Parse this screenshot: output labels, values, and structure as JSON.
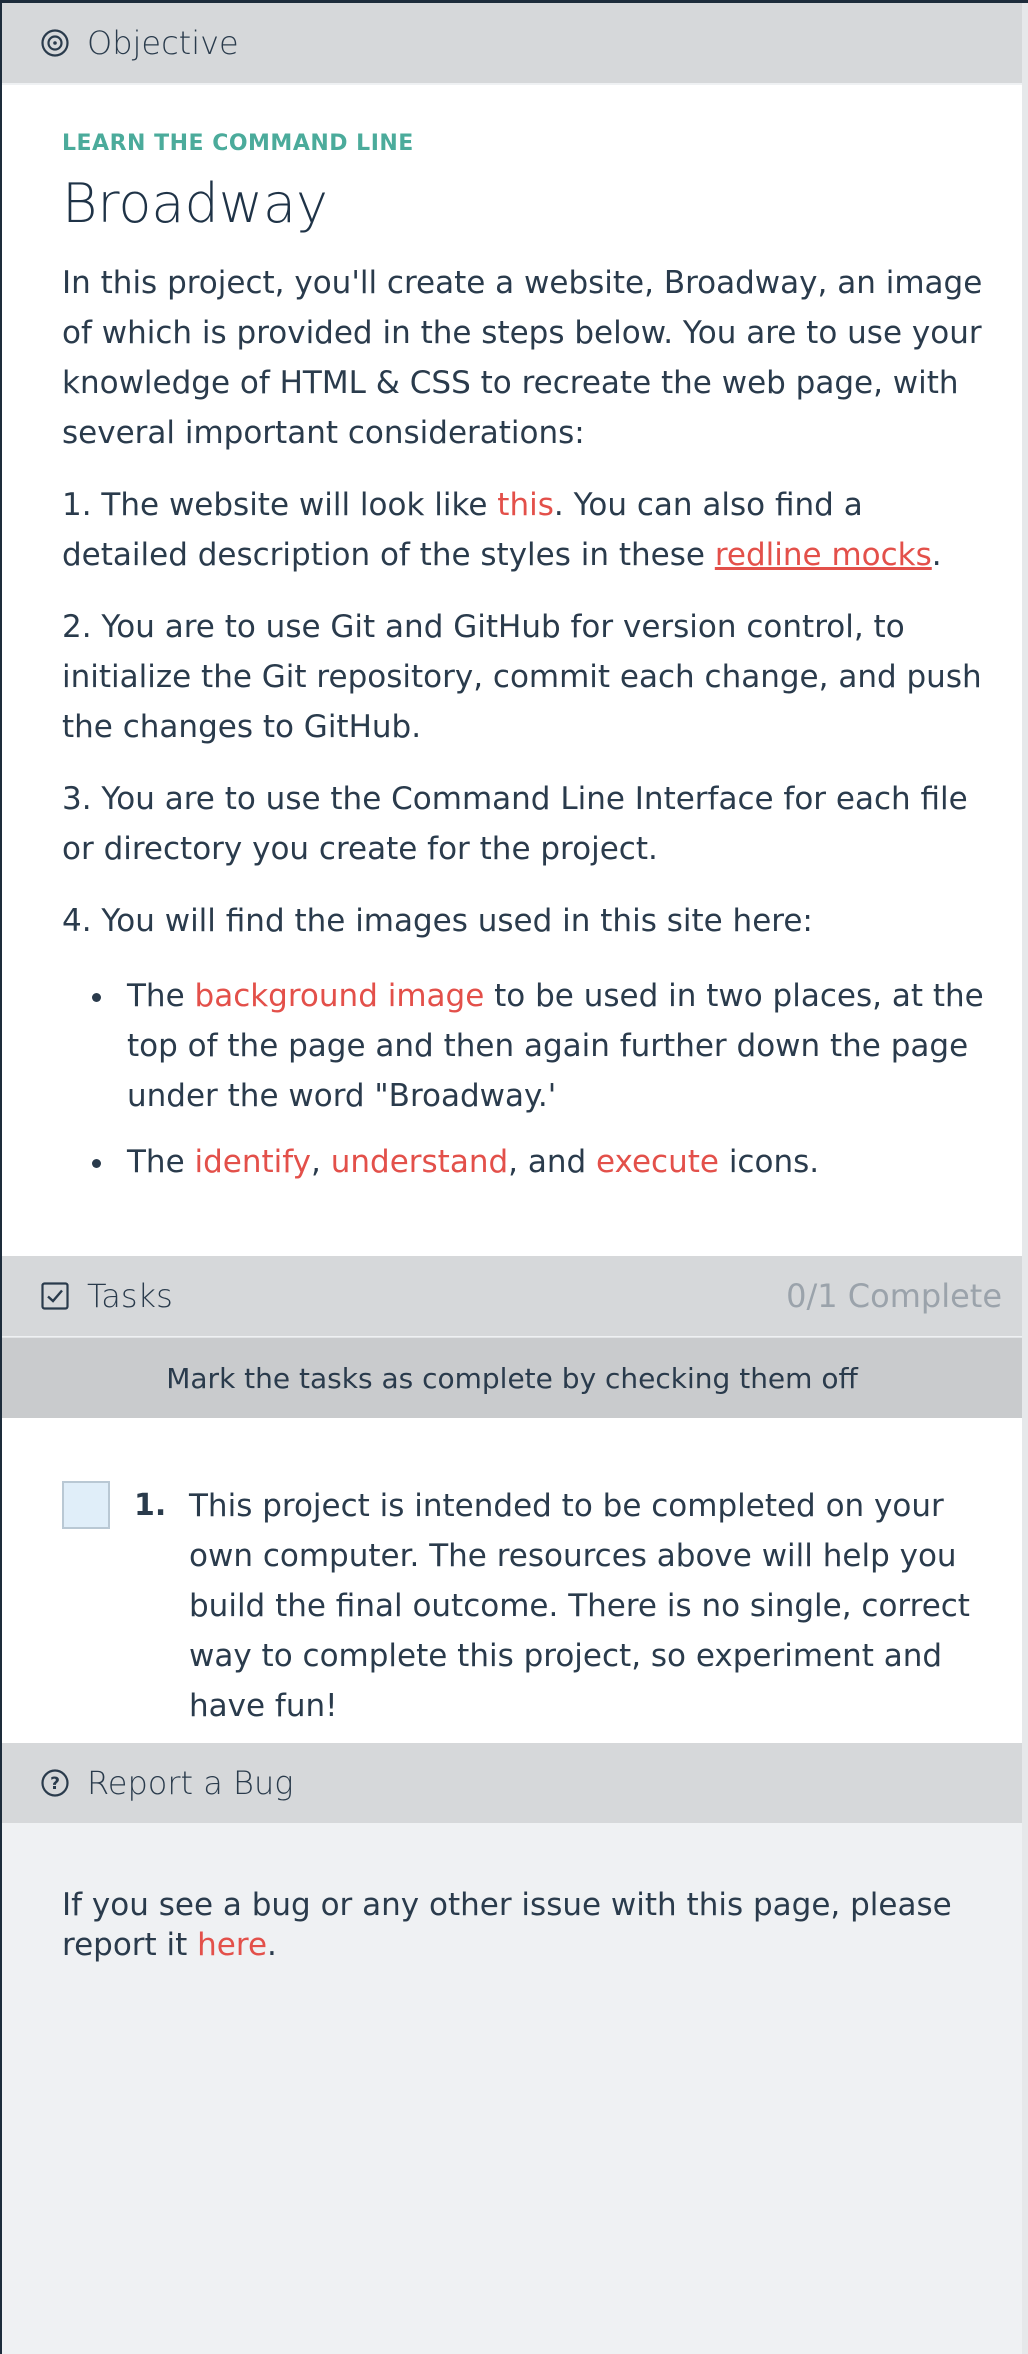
{
  "objective": {
    "header_title": "Objective",
    "icon": "target-icon",
    "overline": "LEARN THE COMMAND LINE",
    "title": "Broadway",
    "intro": "In this project, you'll create a website, Broadway, an image of which is provided in the steps below. You are to use your knowledge of HTML & CSS to recreate the web page, with several important considerations:",
    "item1": {
      "before": "1. The website will look like ",
      "link1": "this",
      "middle": ". You can also find a detailed description of the styles in these ",
      "link2": "redline mocks",
      "after": "."
    },
    "item2": "2. You are to use Git and GitHub for version control, to initialize the Git repository, commit each change, and push the changes to GitHub.",
    "item3": "3. You are to use the Command Line Interface for each file or directory you create for the project.",
    "item4": "4. You will find the images used in this site here:",
    "bullet1": {
      "before": "The ",
      "link": "background image",
      "after": " to be used in two places, at the top of the page and then again further down the page under the word \"Broadway.'"
    },
    "bullet2": {
      "before": "The ",
      "link1": "identify",
      "sep1": ", ",
      "link2": "understand",
      "sep2": ", and ",
      "link3": "execute",
      "after": " icons."
    }
  },
  "tasks": {
    "header_title": "Tasks",
    "icon": "checkbox-icon",
    "progress": "0/1 Complete",
    "instruction": "Mark the tasks as complete by checking them off",
    "items": [
      {
        "number": "1.",
        "text": "This project is intended to be completed on your own computer. The resources above will help you build the final outcome. There is no single, correct way to complete this project, so experiment and have fun!",
        "checked": false
      }
    ]
  },
  "bug": {
    "header_title": "Report a Bug",
    "icon": "question-circle-icon",
    "before": "If you see a bug or any other issue with this page, please report it ",
    "link": "here",
    "after": "."
  },
  "colors": {
    "accent": "#e3504a",
    "overline": "#4bab9b",
    "text": "#2a3b4c"
  }
}
